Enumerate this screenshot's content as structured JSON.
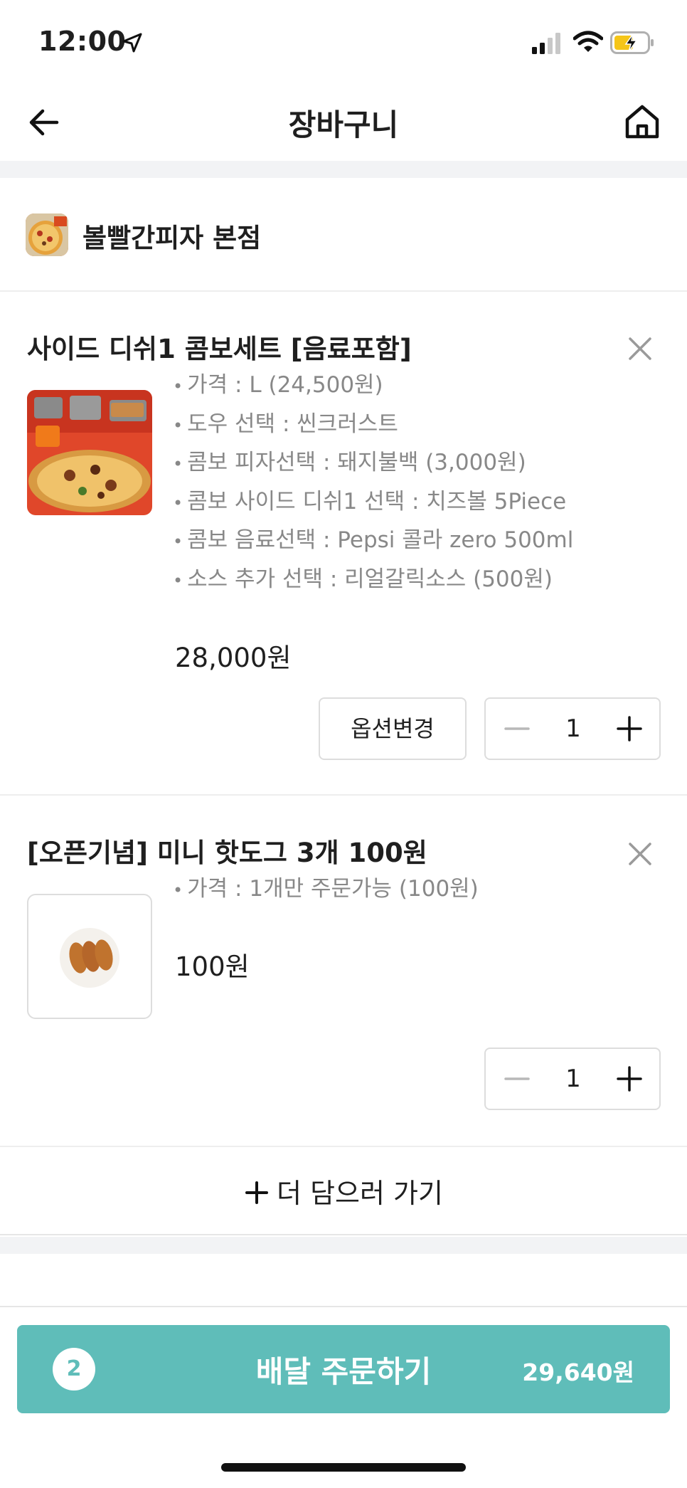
{
  "status_bar": {
    "time": "12:00"
  },
  "header": {
    "title": "장바구니"
  },
  "store": {
    "name": "볼빨간피자 본점"
  },
  "items": [
    {
      "title": "사이드 디쉬1 콤보세트 [음료포함]",
      "options": [
        "가격 : L (24,500원)",
        "도우 선택 : 씬크러스트",
        "콤보 피자선택 : 돼지불백 (3,000원)",
        "콤보 사이드 디쉬1 선택 : 치즈볼 5Piece",
        "콤보 음료선택 : Pepsi 콜라 zero 500ml",
        "소스 추가 선택 : 리얼갈릭소스 (500원)"
      ],
      "price": "28,000원",
      "option_button_label": "옵션변경",
      "quantity": "1"
    },
    {
      "title": "[오픈기념] 미니 핫도그 3개 100원",
      "options": [
        "가격 : 1개만 주문가능 (100원)"
      ],
      "price": "100원",
      "quantity": "1"
    }
  ],
  "add_more_label": "더 담으러 가기",
  "order_button": {
    "count": "2",
    "label": "배달 주문하기",
    "total": "29,640원"
  },
  "colors": {
    "accent": "#5fbdb9",
    "divider": "#f2f3f5",
    "option_text": "#888888"
  }
}
